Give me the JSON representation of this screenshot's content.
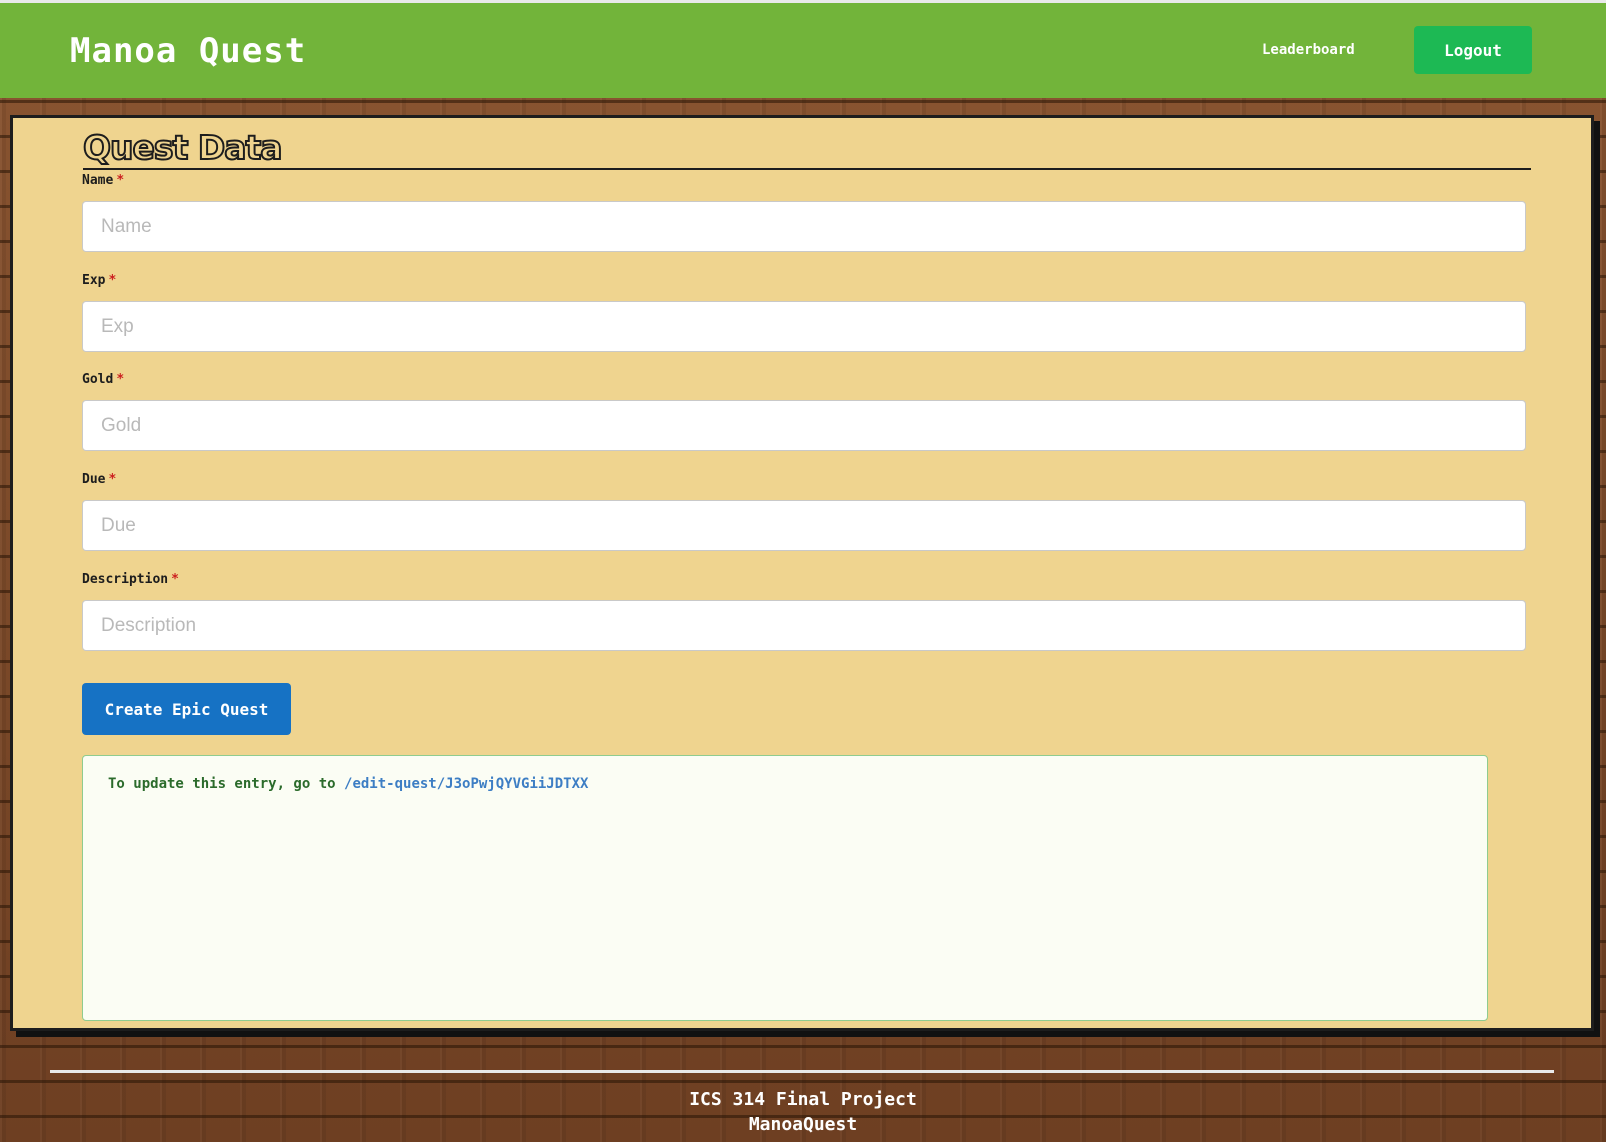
{
  "navbar": {
    "brand": "Manoa Quest",
    "links": {
      "leaderboard": "Leaderboard"
    },
    "logout_label": "Logout",
    "colors": {
      "background": "#72b43a",
      "logout": "#1db954"
    }
  },
  "form": {
    "title": "Quest Data",
    "fields": [
      {
        "label": "Name",
        "placeholder": "Name",
        "value": "",
        "required": true
      },
      {
        "label": "Exp",
        "placeholder": "Exp",
        "value": "",
        "required": true
      },
      {
        "label": "Gold",
        "placeholder": "Gold",
        "value": "",
        "required": true
      },
      {
        "label": "Due",
        "placeholder": "Due",
        "value": "",
        "required": true
      },
      {
        "label": "Description",
        "placeholder": "Description",
        "value": "",
        "required": true
      }
    ],
    "required_marker": "*",
    "submit_label": "Create Epic Quest",
    "colors": {
      "panel": "#efd48f",
      "submit": "#1672c4"
    }
  },
  "message": {
    "prefix": "To update this entry, go to ",
    "link": "/edit-quest/J3oPwjQYVGiiJDTXX"
  },
  "footer": {
    "line1": "ICS 314 Final Project",
    "line2": "ManoaQuest"
  }
}
